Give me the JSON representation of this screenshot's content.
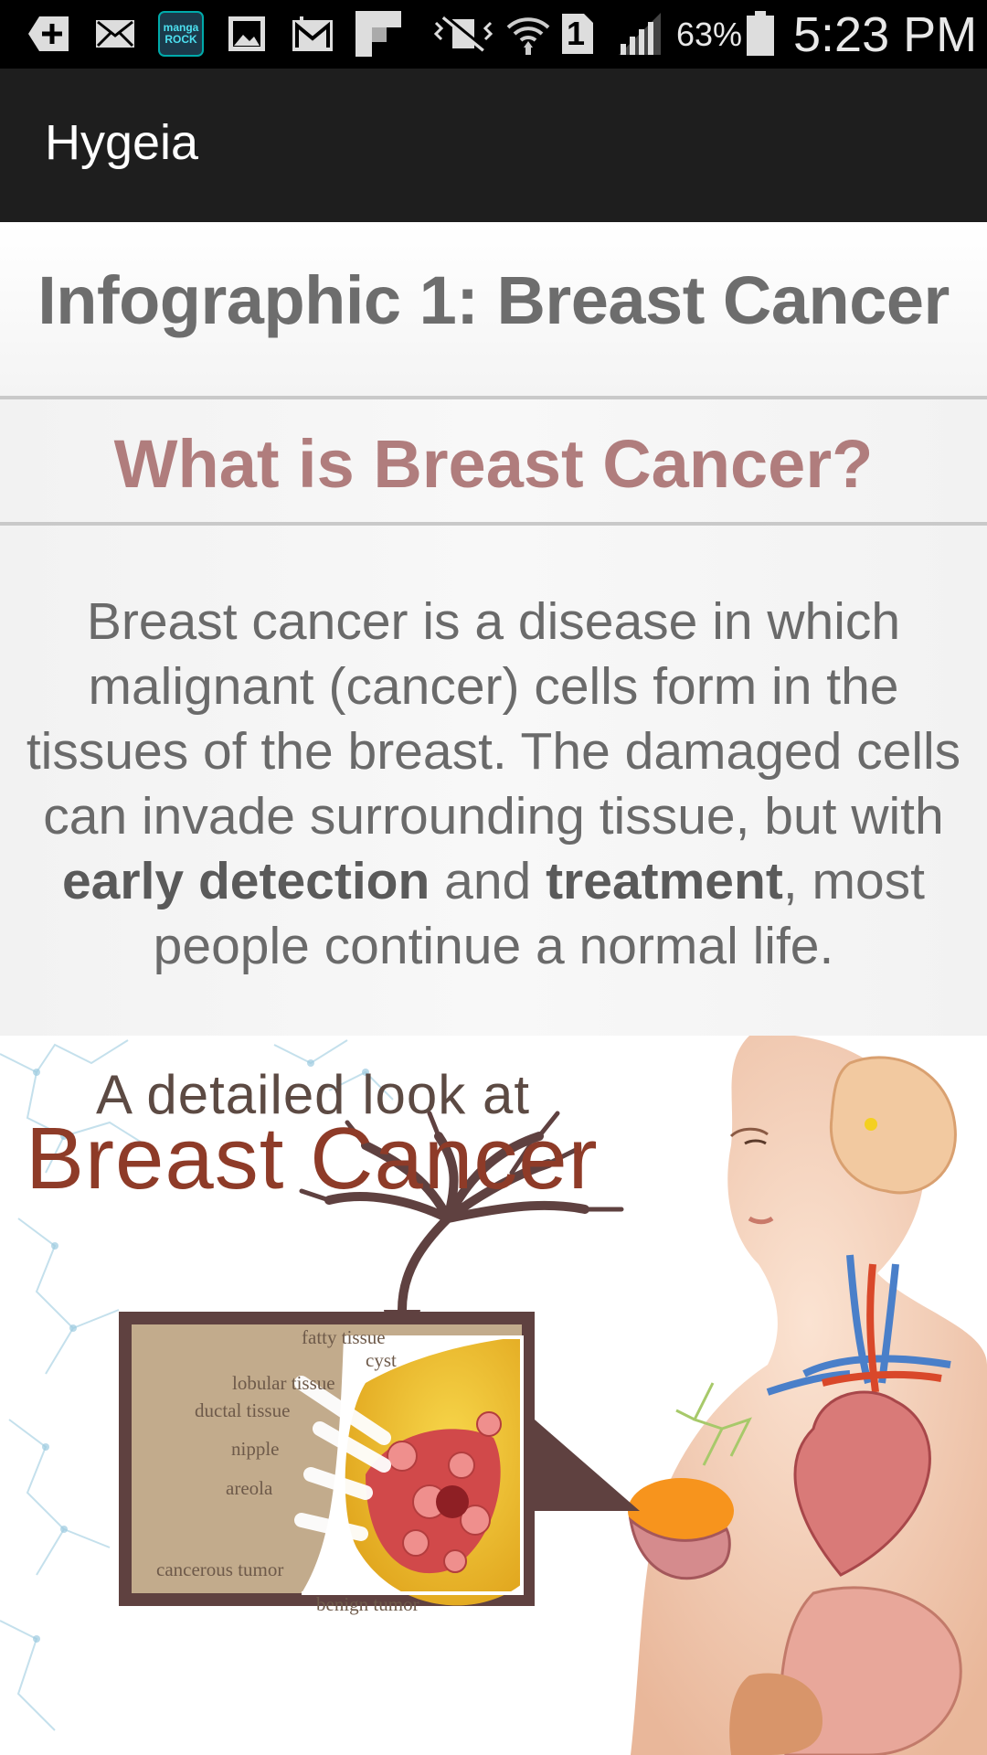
{
  "status_bar": {
    "icons": [
      "add-icon",
      "email-icon",
      "manga-rock-icon",
      "gallery-icon",
      "gmail-icon",
      "flipboard-icon",
      "vibrate-mute-icon",
      "wifi-icon",
      "sim-1-icon",
      "cell-signal-icon",
      "battery-icon"
    ],
    "manga_rock_label": "manga ROCK",
    "sim_label": "1",
    "battery_percent": "63%",
    "clock": "5:23 PM"
  },
  "app_bar": {
    "title": "Hygeia"
  },
  "content": {
    "title": "Infographic 1: Breast Cancer",
    "section_heading": "What is Breast Cancer?",
    "body": {
      "part1": "Breast cancer is a disease in which malignant (cancer) cells form in the tissues of the breast. The damaged cells can invade surrounding tissue, but with ",
      "bold1": "early detection",
      "part2": " and ",
      "bold2": "treatment",
      "part3": ", most people continue a normal life."
    }
  },
  "infographic": {
    "heading_line1": "A detailed look at",
    "heading_line2": "Breast Cancer",
    "labels": {
      "fatty_tissue": "fatty tissue",
      "cyst": "cyst",
      "lobular_tissue": "lobular tissue",
      "ductal_tissue": "ductal tissue",
      "nipple": "nipple",
      "areola": "areola",
      "cancerous_tumor": "cancerous tumor",
      "benign_tumor": "benign tumor"
    }
  },
  "colors": {
    "status_bar_bg": "#000000",
    "app_bar_bg": "#1e1e1e",
    "title_text": "#6d6d6d",
    "section_heading_text": "#b07d7d",
    "body_text": "#6a6a6a"
  }
}
